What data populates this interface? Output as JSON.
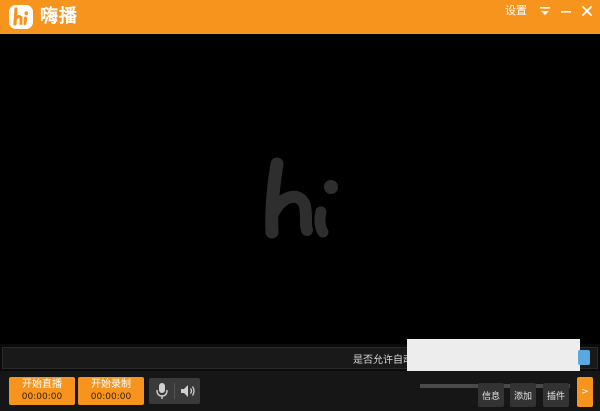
{
  "app": {
    "title": "嗨播",
    "settings_label": "设置"
  },
  "colors": {
    "accent": "#f7941d",
    "background": "#000000"
  },
  "notice": {
    "text": "是否允许自动"
  },
  "controls": {
    "start_live_label": "开始直播",
    "start_live_time": "00:00:00",
    "start_record_label": "开始录制",
    "start_record_time": "00:00:00",
    "info_label": "信息",
    "add_label": "添加",
    "plugin_label": "插件",
    "toggle_glyph": ">"
  },
  "icons": [
    "hi-logo-icon",
    "dropdown-icon",
    "minimize-icon",
    "close-icon",
    "microphone-icon",
    "speaker-icon",
    "hi-watermark-icon"
  ]
}
